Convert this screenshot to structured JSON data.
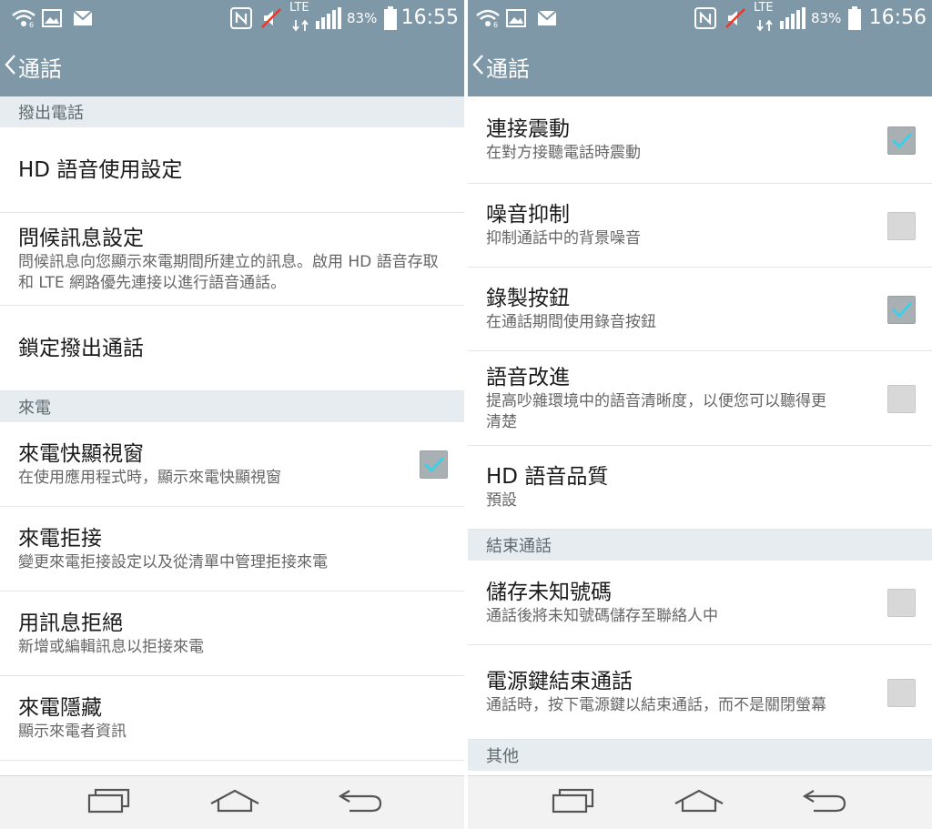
{
  "left": {
    "status": {
      "battery": "83%",
      "time": "16:55",
      "lte": "LTE"
    },
    "title": "通話",
    "rows": [
      {
        "type": "section",
        "label": "撥出電話",
        "h": 34
      },
      {
        "type": "item",
        "title": "HD 語音使用設定",
        "h": 94
      },
      {
        "type": "item",
        "title": "問候訊息設定",
        "subtitle": "問候訊息向您顯示來電期間所建立的訊息。啟用 HD 語音存取和 LTE 網路優先連接以進行語音通話。",
        "h": 102
      },
      {
        "type": "item",
        "title": "鎖定撥出通話",
        "h": 94
      },
      {
        "type": "section",
        "label": "來電",
        "h": 34
      },
      {
        "type": "item",
        "title": "來電快顯視窗",
        "subtitle": "在使用應用程式時，顯示來電快顯視窗",
        "checkbox": true,
        "checked": true,
        "h": 93
      },
      {
        "type": "item",
        "title": "來電拒接",
        "subtitle": "變更來電拒接設定以及從清單中管理拒接來電",
        "h": 93
      },
      {
        "type": "item",
        "title": "用訊息拒絕",
        "subtitle": "新增或編輯訊息以拒接來電",
        "h": 93
      },
      {
        "type": "item",
        "title": "來電隱藏",
        "subtitle": "顯示來電者資訊",
        "h": 93
      }
    ]
  },
  "right": {
    "status": {
      "battery": "83%",
      "time": "16:56",
      "lte": "LTE"
    },
    "title": "通話",
    "rows": [
      {
        "type": "item",
        "title": "連接震動",
        "subtitle": "在對方接聽電話時震動",
        "checkbox": true,
        "checked": true,
        "h": 96
      },
      {
        "type": "item",
        "title": "噪音抑制",
        "subtitle": "抑制通話中的背景噪音",
        "checkbox": true,
        "checked": false,
        "h": 92
      },
      {
        "type": "item",
        "title": "錄製按鈕",
        "subtitle": "在通話期間使用錄音按鈕",
        "checkbox": true,
        "checked": true,
        "h": 92
      },
      {
        "type": "item",
        "title": "語音改進",
        "subtitle": "提高吵雜環境中的語音清晰度，以便您可以聽得更清楚",
        "checkbox": true,
        "checked": false,
        "h": 104
      },
      {
        "type": "item",
        "title": "HD 語音品質",
        "subtitle": "預設",
        "h": 92
      },
      {
        "type": "section",
        "label": "結束通話",
        "h": 34
      },
      {
        "type": "item",
        "title": "儲存未知號碼",
        "subtitle": "通話後將未知號碼儲存至聯絡人中",
        "checkbox": true,
        "checked": false,
        "h": 93
      },
      {
        "type": "item",
        "title": "電源鍵結束通話",
        "subtitle": "通話時，按下電源鍵以結束通話，而不是關閉螢幕",
        "checkbox": true,
        "checked": false,
        "h": 104
      },
      {
        "type": "section",
        "label": "其他",
        "h": 34
      }
    ]
  },
  "icons": [
    "wifi-icon",
    "image-icon",
    "mail-icon",
    "nfc-icon",
    "mute-icon",
    "signal-icon",
    "battery-icon",
    "back-icon",
    "recent-apps-icon",
    "home-icon",
    "back-nav-icon",
    "checkmark-icon"
  ],
  "colors": {
    "bar": "#7e98a8",
    "section": "#e6ecf0",
    "check": "#3ccfe8"
  }
}
